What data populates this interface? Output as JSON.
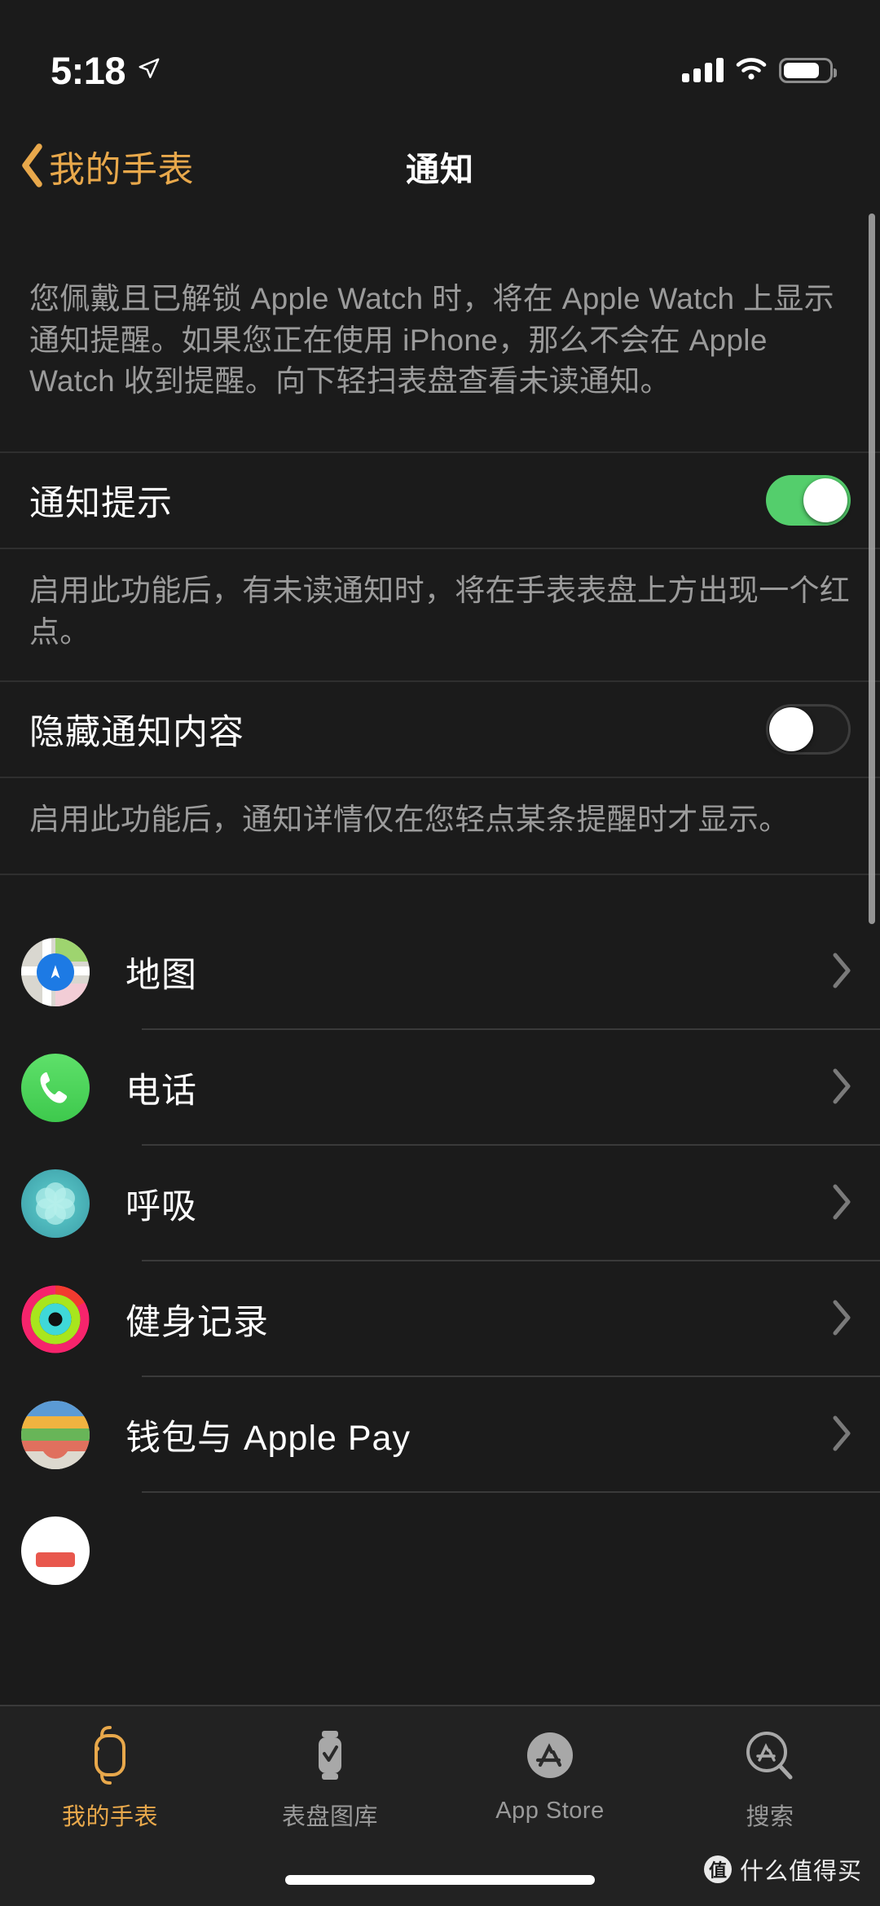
{
  "status_bar": {
    "time": "5:18",
    "location_icon": "location-arrow-icon",
    "cellular_icon": "cellular-signal-icon",
    "wifi_icon": "wifi-icon",
    "battery_icon": "battery-icon"
  },
  "nav": {
    "back_label": "我的手表",
    "back_icon": "chevron-left-icon",
    "title": "通知",
    "accent_color": "#e8a84b"
  },
  "intro_note": "您佩戴且已解锁 Apple Watch 时，将在 Apple Watch 上显示通知提醒。如果您正在使用 iPhone，那么不会在 Apple Watch 收到提醒。向下轻扫表盘查看未读通知。",
  "settings": [
    {
      "label": "通知提示",
      "state": "on",
      "note": "启用此功能后，有未读通知时，将在手表表盘上方出现一个红点。"
    },
    {
      "label": "隐藏通知内容",
      "state": "off",
      "note": "启用此功能后，通知详情仅在您轻点某条提醒时才显示。"
    }
  ],
  "apps": [
    {
      "name": "地图",
      "icon": "maps-app-icon"
    },
    {
      "name": "电话",
      "icon": "phone-app-icon"
    },
    {
      "name": "呼吸",
      "icon": "breathe-app-icon"
    },
    {
      "name": "健身记录",
      "icon": "activity-app-icon"
    },
    {
      "name": "钱包与 Apple Pay",
      "icon": "wallet-app-icon"
    }
  ],
  "tabs": [
    {
      "label": "我的手表",
      "icon": "watch-icon",
      "active": true
    },
    {
      "label": "表盘图库",
      "icon": "face-gallery-icon",
      "active": false
    },
    {
      "label": "App Store",
      "icon": "app-store-icon",
      "active": false
    },
    {
      "label": "搜索",
      "icon": "search-app-store-icon",
      "active": false
    }
  ],
  "watermark": {
    "badge": "值",
    "text": "什么值得买"
  },
  "colors": {
    "background": "#1b1b1b",
    "accent": "#e8a84b",
    "switch_on": "#54ce6c",
    "secondary_text": "#9b9b9b"
  }
}
